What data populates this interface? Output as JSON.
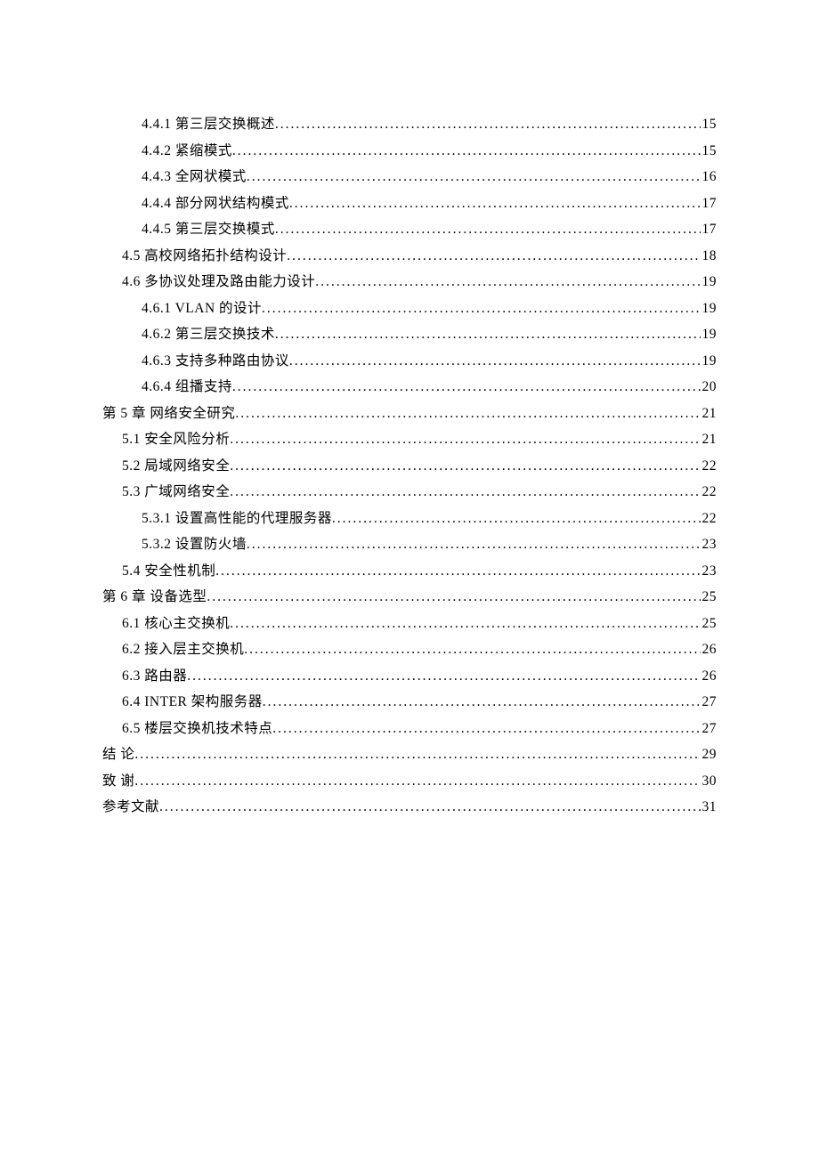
{
  "toc": [
    {
      "level": 2,
      "label": "4.4.1 第三层交换概述",
      "page": "15"
    },
    {
      "level": 2,
      "label": "4.4.2 紧缩模式",
      "page": "15"
    },
    {
      "level": 2,
      "label": "4.4.3 全网状模式",
      "page": "16"
    },
    {
      "level": 2,
      "label": "4.4.4 部分网状结构模式",
      "page": "17"
    },
    {
      "level": 2,
      "label": "4.4.5 第三层交换模式",
      "page": "17"
    },
    {
      "level": 1,
      "label": "4.5 高校网络拓扑结构设计",
      "page": "18"
    },
    {
      "level": 1,
      "label": "4.6 多协议处理及路由能力设计",
      "page": "19"
    },
    {
      "level": 2,
      "label": "4.6.1 VLAN 的设计 ",
      "page": "19"
    },
    {
      "level": 2,
      "label": "4.6.2 第三层交换技术",
      "page": "19"
    },
    {
      "level": 2,
      "label": "4.6.3 支持多种路由协议",
      "page": "19"
    },
    {
      "level": 2,
      "label": "4.6.4 组播支持",
      "page": "20"
    },
    {
      "level": 0,
      "label": "第 5 章 网络安全研究 ",
      "page": "21"
    },
    {
      "level": 1,
      "label": "5.1 安全风险分析",
      "page": "21"
    },
    {
      "level": 1,
      "label": "5.2 局域网络安全",
      "page": "22"
    },
    {
      "level": 1,
      "label": "5.3 广域网络安全",
      "page": "22"
    },
    {
      "level": 2,
      "label": "5.3.1 设置高性能的代理服务器",
      "page": "22"
    },
    {
      "level": 2,
      "label": "5.3.2 设置防火墙",
      "page": "23"
    },
    {
      "level": 1,
      "label": "5.4 安全性机制",
      "page": "23"
    },
    {
      "level": 0,
      "label": "第 6 章 设备选型 ",
      "page": "25"
    },
    {
      "level": 1,
      "label": "6.1 核心主交换机",
      "page": "25"
    },
    {
      "level": 1,
      "label": "6.2 接入层主交换机",
      "page": "26"
    },
    {
      "level": 1,
      "label": "6.3 路由器",
      "page": "26"
    },
    {
      "level": 1,
      "label": "6.4 INTER 架构服务器 ",
      "page": "27"
    },
    {
      "level": 1,
      "label": "6.5 楼层交换机技术特点",
      "page": "27"
    },
    {
      "level": 0,
      "label": "结 论 ",
      "page": "29"
    },
    {
      "level": 0,
      "label": "致 谢 ",
      "page": "30"
    },
    {
      "level": 0,
      "label": "参考文献 ",
      "page": "31"
    }
  ]
}
